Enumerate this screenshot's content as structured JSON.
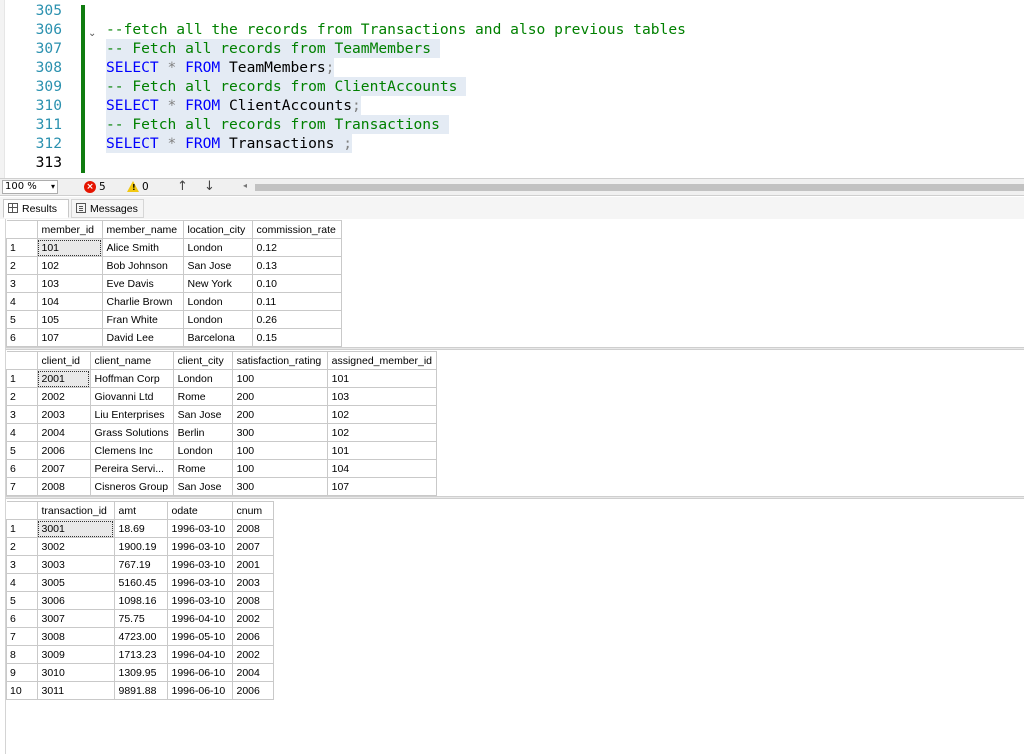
{
  "editor": {
    "lines": [
      {
        "num": "305",
        "segments": []
      },
      {
        "num": "306",
        "segments": [
          {
            "t": "cm",
            "v": "--fetch all the records from Transactions and also previous tables"
          }
        ]
      },
      {
        "num": "307",
        "segments": [
          {
            "t": "cm",
            "v": "-- Fetch all records from TeamMembers "
          }
        ]
      },
      {
        "num": "308",
        "segments": [
          {
            "t": "kw",
            "v": "SELECT"
          },
          {
            "t": "op",
            "v": " * "
          },
          {
            "t": "kw",
            "v": "FROM"
          },
          {
            "t": "id",
            "v": " TeamMembers"
          },
          {
            "t": "op",
            "v": ";"
          }
        ]
      },
      {
        "num": "309",
        "segments": [
          {
            "t": "cm",
            "v": "-- Fetch all records from ClientAccounts "
          }
        ]
      },
      {
        "num": "310",
        "segments": [
          {
            "t": "kw",
            "v": "SELECT"
          },
          {
            "t": "op",
            "v": " * "
          },
          {
            "t": "kw",
            "v": "FROM"
          },
          {
            "t": "id",
            "v": " ClientAccounts"
          },
          {
            "t": "op",
            "v": ";"
          }
        ]
      },
      {
        "num": "311",
        "segments": [
          {
            "t": "cm",
            "v": "-- Fetch all records from Transactions "
          }
        ]
      },
      {
        "num": "312",
        "segments": [
          {
            "t": "kw",
            "v": "SELECT"
          },
          {
            "t": "op",
            "v": " * "
          },
          {
            "t": "kw",
            "v": "FROM"
          },
          {
            "t": "id",
            "v": " Transactions "
          },
          {
            "t": "op",
            "v": ";"
          }
        ]
      },
      {
        "num": "313",
        "segments": []
      }
    ],
    "fold_glyph": "⌄"
  },
  "status": {
    "zoom": "100 %",
    "zoom_dropdown": "▾",
    "errors_icon": "×",
    "errors": "5",
    "warnings_icon": "!",
    "warnings": "0",
    "nav_up": "↑",
    "nav_down": "↓",
    "scroll_left": "◂"
  },
  "tabs": {
    "results": "Results",
    "messages": "Messages"
  },
  "grids": [
    {
      "columns": [
        "member_id",
        "member_name",
        "location_city",
        "commission_rate"
      ],
      "rows": [
        [
          "101",
          "Alice Smith",
          "London",
          "0.12"
        ],
        [
          "102",
          "Bob Johnson",
          "San Jose",
          "0.13"
        ],
        [
          "103",
          "Eve Davis",
          "New York",
          "0.10"
        ],
        [
          "104",
          "Charlie Brown",
          "London",
          "0.11"
        ],
        [
          "105",
          "Fran White",
          "London",
          "0.26"
        ],
        [
          "107",
          "David Lee",
          "Barcelona",
          "0.15"
        ]
      ]
    },
    {
      "columns": [
        "client_id",
        "client_name",
        "client_city",
        "satisfaction_rating",
        "assigned_member_id"
      ],
      "rows": [
        [
          "2001",
          "Hoffman Corp",
          "London",
          "100",
          "101"
        ],
        [
          "2002",
          "Giovanni Ltd",
          "Rome",
          "200",
          "103"
        ],
        [
          "2003",
          "Liu Enterprises",
          "San Jose",
          "200",
          "102"
        ],
        [
          "2004",
          "Grass Solutions",
          "Berlin",
          "300",
          "102"
        ],
        [
          "2006",
          "Clemens Inc",
          "London",
          "100",
          "101"
        ],
        [
          "2007",
          "Pereira Servi...",
          "Rome",
          "100",
          "104"
        ],
        [
          "2008",
          "Cisneros Group",
          "San Jose",
          "300",
          "107"
        ]
      ]
    },
    {
      "columns": [
        "transaction_id",
        "amt",
        "odate",
        "cnum"
      ],
      "rows": [
        [
          "3001",
          "18.69",
          "1996-03-10",
          "2008"
        ],
        [
          "3002",
          "1900.19",
          "1996-03-10",
          "2007"
        ],
        [
          "3003",
          "767.19",
          "1996-03-10",
          "2001"
        ],
        [
          "3005",
          "5160.45",
          "1996-03-10",
          "2003"
        ],
        [
          "3006",
          "1098.16",
          "1996-03-10",
          "2008"
        ],
        [
          "3007",
          "75.75",
          "1996-04-10",
          "2002"
        ],
        [
          "3008",
          "4723.00",
          "1996-05-10",
          "2006"
        ],
        [
          "3009",
          "1713.23",
          "1996-04-10",
          "2002"
        ],
        [
          "3010",
          "1309.95",
          "1996-06-10",
          "2004"
        ],
        [
          "3011",
          "9891.88",
          "1996-06-10",
          "2006"
        ]
      ]
    }
  ]
}
